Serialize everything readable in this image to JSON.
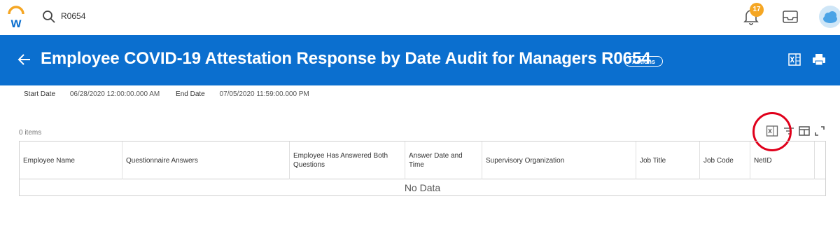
{
  "topbar": {
    "search_value": "R0654",
    "notification_count": "17"
  },
  "header": {
    "title": "Employee COVID-19 Attestation Response by Date Audit for Managers R0654",
    "actions_label": "Actions"
  },
  "params": {
    "start_label": "Start Date",
    "start_value": "06/28/2020 12:00:00.000 AM",
    "end_label": "End Date",
    "end_value": "07/05/2020 11:59:00.000 PM"
  },
  "table": {
    "items_count": "0 items",
    "columns": [
      "Employee Name",
      "Questionnaire Answers",
      "Employee Has Answered Both Questions",
      "Answer Date and Time",
      "Supervisory Organization",
      "Job Title",
      "Job Code",
      "NetID"
    ],
    "empty_message": "No Data"
  },
  "colors": {
    "header_bg": "#0b6fcf",
    "badge": "#f5a623",
    "annotation": "#e0001b"
  },
  "icons": [
    "workday-logo-icon",
    "search-icon",
    "bell-icon",
    "inbox-icon",
    "cloud-avatar-icon",
    "back-arrow-icon",
    "excel-icon",
    "print-icon",
    "filter-icon",
    "columns-icon",
    "fullscreen-icon"
  ]
}
